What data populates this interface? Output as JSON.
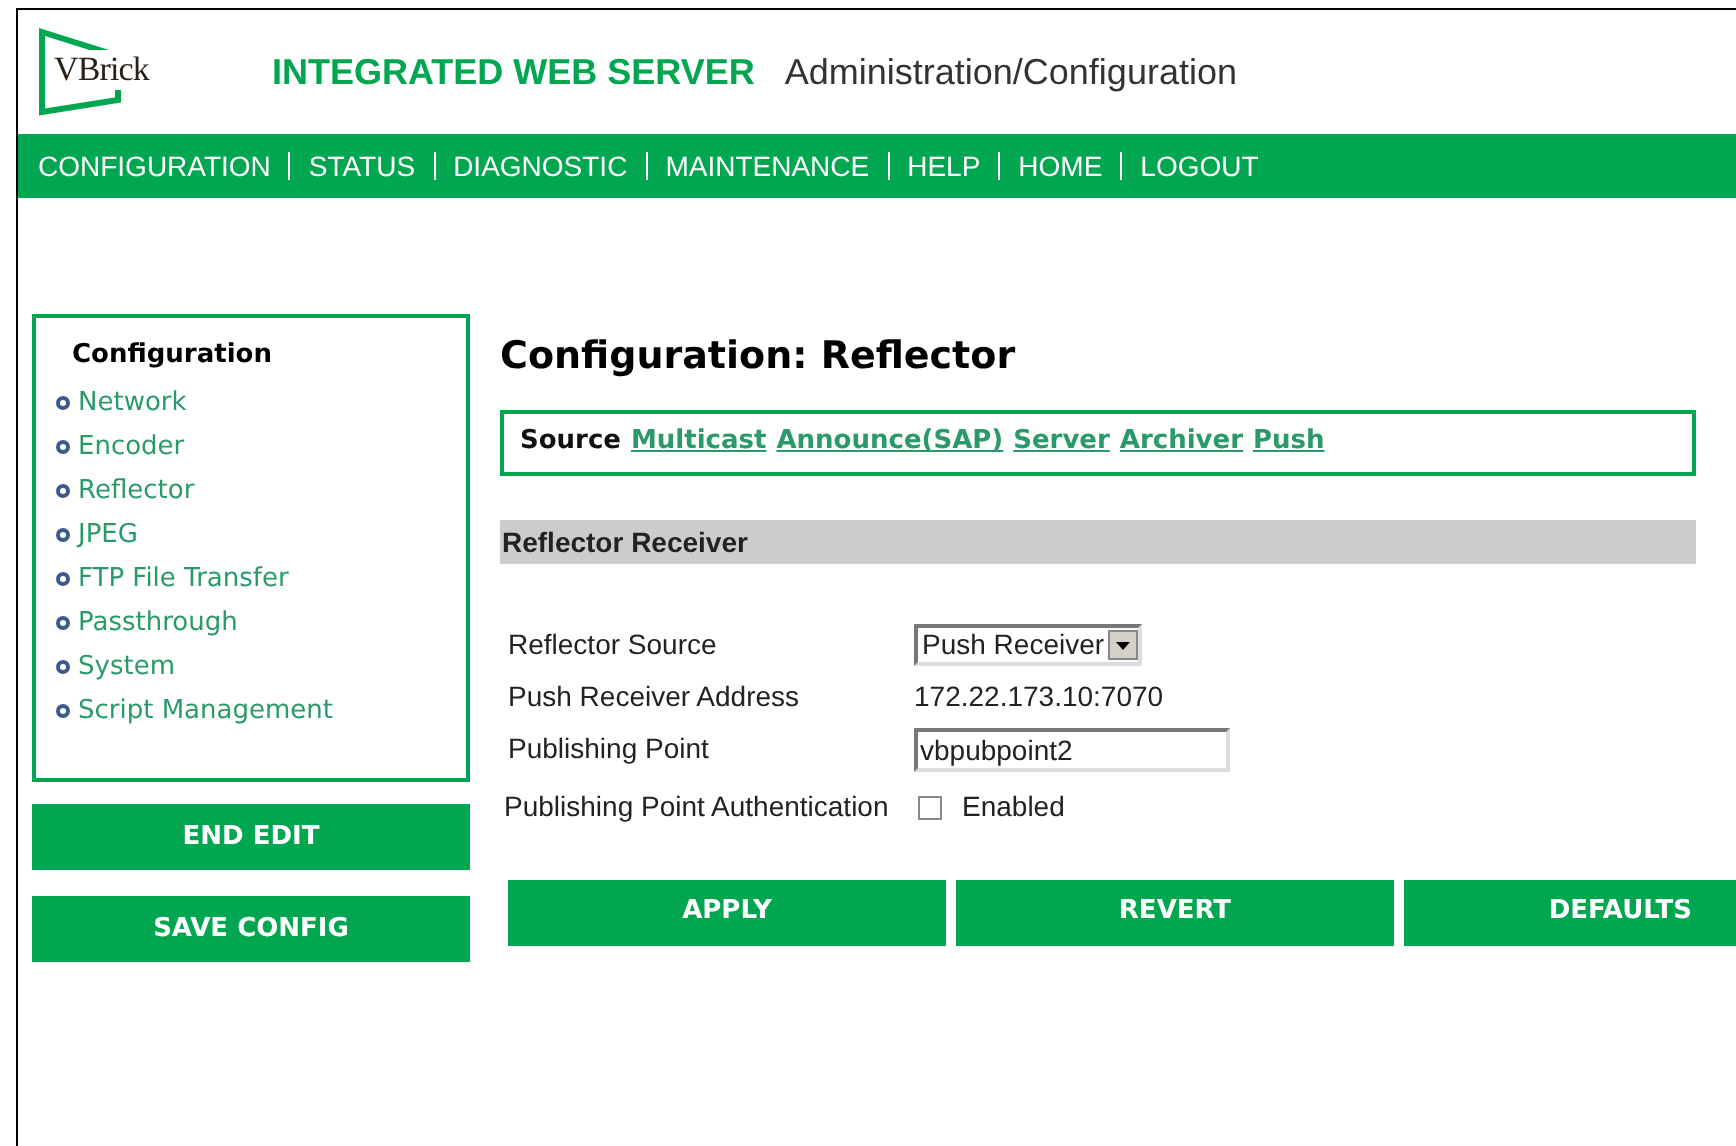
{
  "header": {
    "logo": "VBrick",
    "title": "INTEGRATED WEB SERVER",
    "subtitle": "Administration/Configuration"
  },
  "nav": [
    "CONFIGURATION",
    "STATUS",
    "DIAGNOSTIC",
    "MAINTENANCE",
    "HELP",
    "HOME",
    "LOGOUT"
  ],
  "sidebar": {
    "title": "Configuration",
    "items": [
      "Network",
      "Encoder",
      "Reflector",
      "JPEG",
      "FTP File Transfer",
      "Passthrough",
      "System",
      "Script Management"
    ],
    "buttons": [
      "END EDIT",
      "SAVE CONFIG"
    ]
  },
  "main": {
    "title": "Configuration: Reflector",
    "source_bar": {
      "label": "Source",
      "links": [
        "Multicast",
        "Announce(SAP)",
        "Server",
        "Archiver",
        "Push"
      ]
    },
    "section": "Reflector Receiver",
    "fields": [
      {
        "kind": "select",
        "label": "Reflector Source",
        "value": "Push Receiver"
      },
      {
        "kind": "text",
        "label": "Push Receiver Address",
        "value": "172.22.173.10:7070"
      },
      {
        "kind": "input",
        "label": "Publishing Point",
        "value": "vbpubpoint2"
      },
      {
        "kind": "checkbox",
        "label": "Publishing Point Authentication",
        "option": "Enabled",
        "checked": false
      }
    ],
    "buttons": [
      "APPLY",
      "REVERT",
      "DEFAULTS"
    ]
  }
}
